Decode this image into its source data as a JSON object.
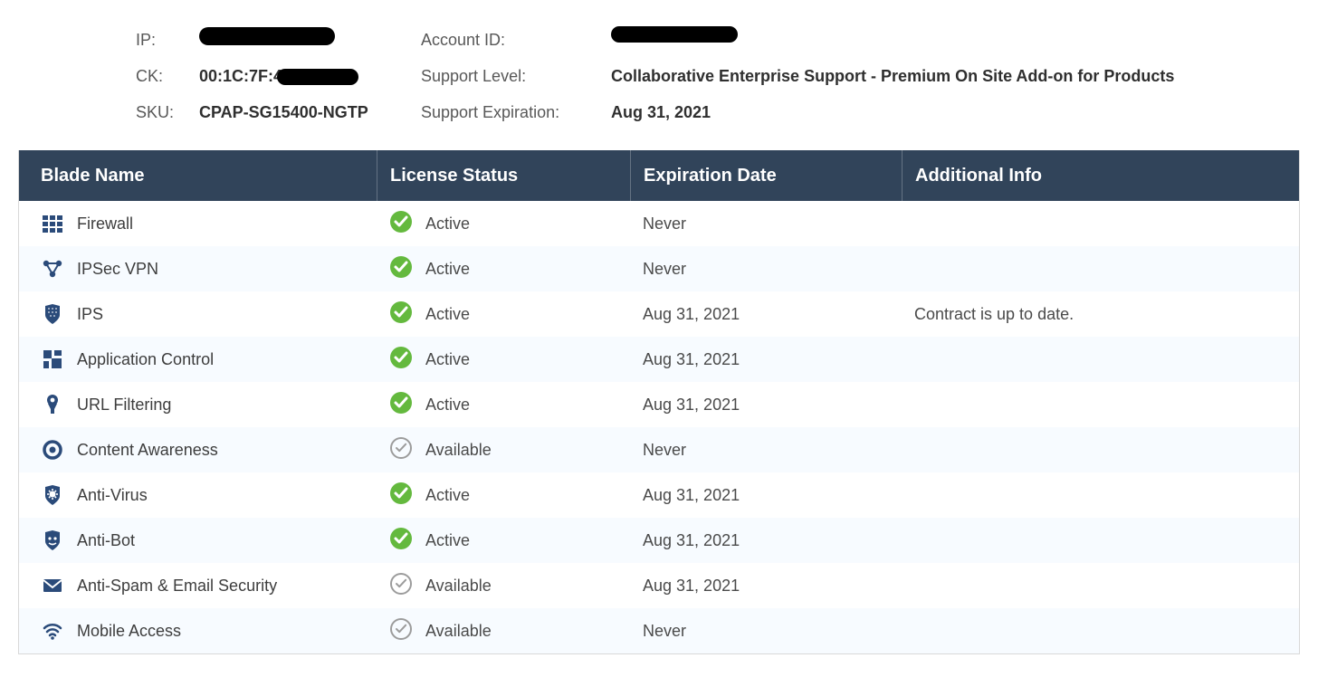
{
  "info": {
    "ip_label": "IP:",
    "ip_value_redacted": true,
    "ck_label": "CK:",
    "ck_value_prefix": "00:1C:7F:4",
    "ck_value_redacted": true,
    "sku_label": "SKU:",
    "sku_value": "CPAP-SG15400-NGTP",
    "account_id_label": "Account ID:",
    "account_id_value_redacted": true,
    "support_level_label": "Support Level:",
    "support_level_value": "Collaborative Enterprise Support - Premium On Site Add-on for Products",
    "support_expiration_label": "Support Expiration:",
    "support_expiration_value": "Aug 31, 2021"
  },
  "table": {
    "headers": {
      "blade": "Blade Name",
      "status": "License Status",
      "expiration": "Expiration Date",
      "info": "Additional Info"
    },
    "status_labels": {
      "active": "Active",
      "available": "Available"
    },
    "rows": [
      {
        "icon": "grid",
        "name": "Firewall",
        "status": "active",
        "expiration": "Never",
        "info": ""
      },
      {
        "icon": "nodes",
        "name": "IPSec VPN",
        "status": "active",
        "expiration": "Never",
        "info": ""
      },
      {
        "icon": "shield-grid",
        "name": "IPS",
        "status": "active",
        "expiration": "Aug 31, 2021",
        "info": "Contract is up to date."
      },
      {
        "icon": "squares",
        "name": "Application Control",
        "status": "active",
        "expiration": "Aug 31, 2021",
        "info": ""
      },
      {
        "icon": "funnel",
        "name": "URL Filtering",
        "status": "active",
        "expiration": "Aug 31, 2021",
        "info": ""
      },
      {
        "icon": "target",
        "name": "Content Awareness",
        "status": "available",
        "expiration": "Never",
        "info": ""
      },
      {
        "icon": "shield-virus",
        "name": "Anti-Virus",
        "status": "active",
        "expiration": "Aug 31, 2021",
        "info": ""
      },
      {
        "icon": "shield-bot",
        "name": "Anti-Bot",
        "status": "active",
        "expiration": "Aug 31, 2021",
        "info": ""
      },
      {
        "icon": "mail",
        "name": "Anti-Spam & Email Security",
        "status": "available",
        "expiration": "Aug 31, 2021",
        "info": ""
      },
      {
        "icon": "wifi",
        "name": "Mobile Access",
        "status": "available",
        "expiration": "Never",
        "info": ""
      }
    ]
  }
}
